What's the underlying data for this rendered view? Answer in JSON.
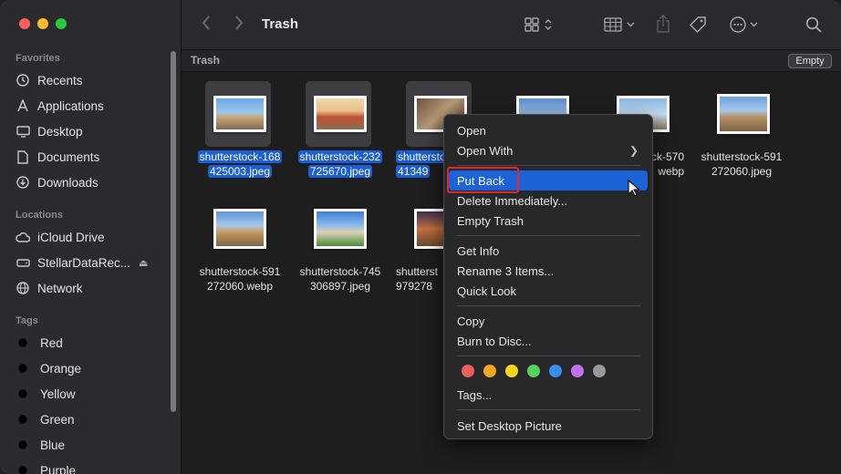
{
  "window": {
    "title": "Trash"
  },
  "sidebar": {
    "favorites_label": "Favorites",
    "favorites": [
      {
        "label": "Recents",
        "icon": "clock-icon"
      },
      {
        "label": "Applications",
        "icon": "applications-icon"
      },
      {
        "label": "Desktop",
        "icon": "desktop-icon"
      },
      {
        "label": "Documents",
        "icon": "document-icon"
      },
      {
        "label": "Downloads",
        "icon": "download-icon"
      }
    ],
    "locations_label": "Locations",
    "locations": [
      {
        "label": "iCloud Drive",
        "icon": "cloud-icon"
      },
      {
        "label": "StellarDataRec...",
        "icon": "drive-icon"
      },
      {
        "label": "Network",
        "icon": "globe-icon"
      }
    ],
    "tags_label": "Tags",
    "tags": [
      {
        "label": "Red"
      },
      {
        "label": "Orange"
      },
      {
        "label": "Yellow"
      },
      {
        "label": "Green"
      },
      {
        "label": "Blue"
      },
      {
        "label": "Purple"
      }
    ]
  },
  "pathbar": {
    "label": "Trash",
    "empty_button": "Empty"
  },
  "files": [
    {
      "line1": "shutterstock-168",
      "line2": "425003.jpeg",
      "selected": true
    },
    {
      "line1": "shutterstock-232",
      "line2": "725670.jpeg",
      "selected": true
    },
    {
      "line1": "shutterstock",
      "line2": "41349",
      "selected": true
    },
    {
      "line1": "",
      "line2": "",
      "selected": false
    },
    {
      "line1": "ck-570",
      "line2": "webp",
      "selected": false
    },
    {
      "line1": "shutterstock-591",
      "line2": "272060.jpeg",
      "selected": false
    },
    {
      "line1": "shutterstock-591",
      "line2": "272060.webp",
      "selected": false
    },
    {
      "line1": "shutterstock-745",
      "line2": "306897.jpeg",
      "selected": false
    },
    {
      "line1": "shutterst",
      "line2": "979278",
      "selected": false
    }
  ],
  "context_menu": {
    "open": "Open",
    "open_with": "Open With",
    "put_back": "Put Back",
    "delete_immediately": "Delete Immediately...",
    "empty_trash": "Empty Trash",
    "get_info": "Get Info",
    "rename": "Rename 3 Items...",
    "quick_look": "Quick Look",
    "copy": "Copy",
    "burn": "Burn to Disc...",
    "tag_colors": [
      "#ec5f5f",
      "#f5a623",
      "#f7d51d",
      "#5ad25a",
      "#3b8ef0",
      "#c471ed",
      "#9a9a9a"
    ],
    "tags": "Tags...",
    "set_desktop": "Set Desktop Picture"
  },
  "colors": {
    "accent": "#1d62d6",
    "highlight_box": "#e8232a"
  }
}
